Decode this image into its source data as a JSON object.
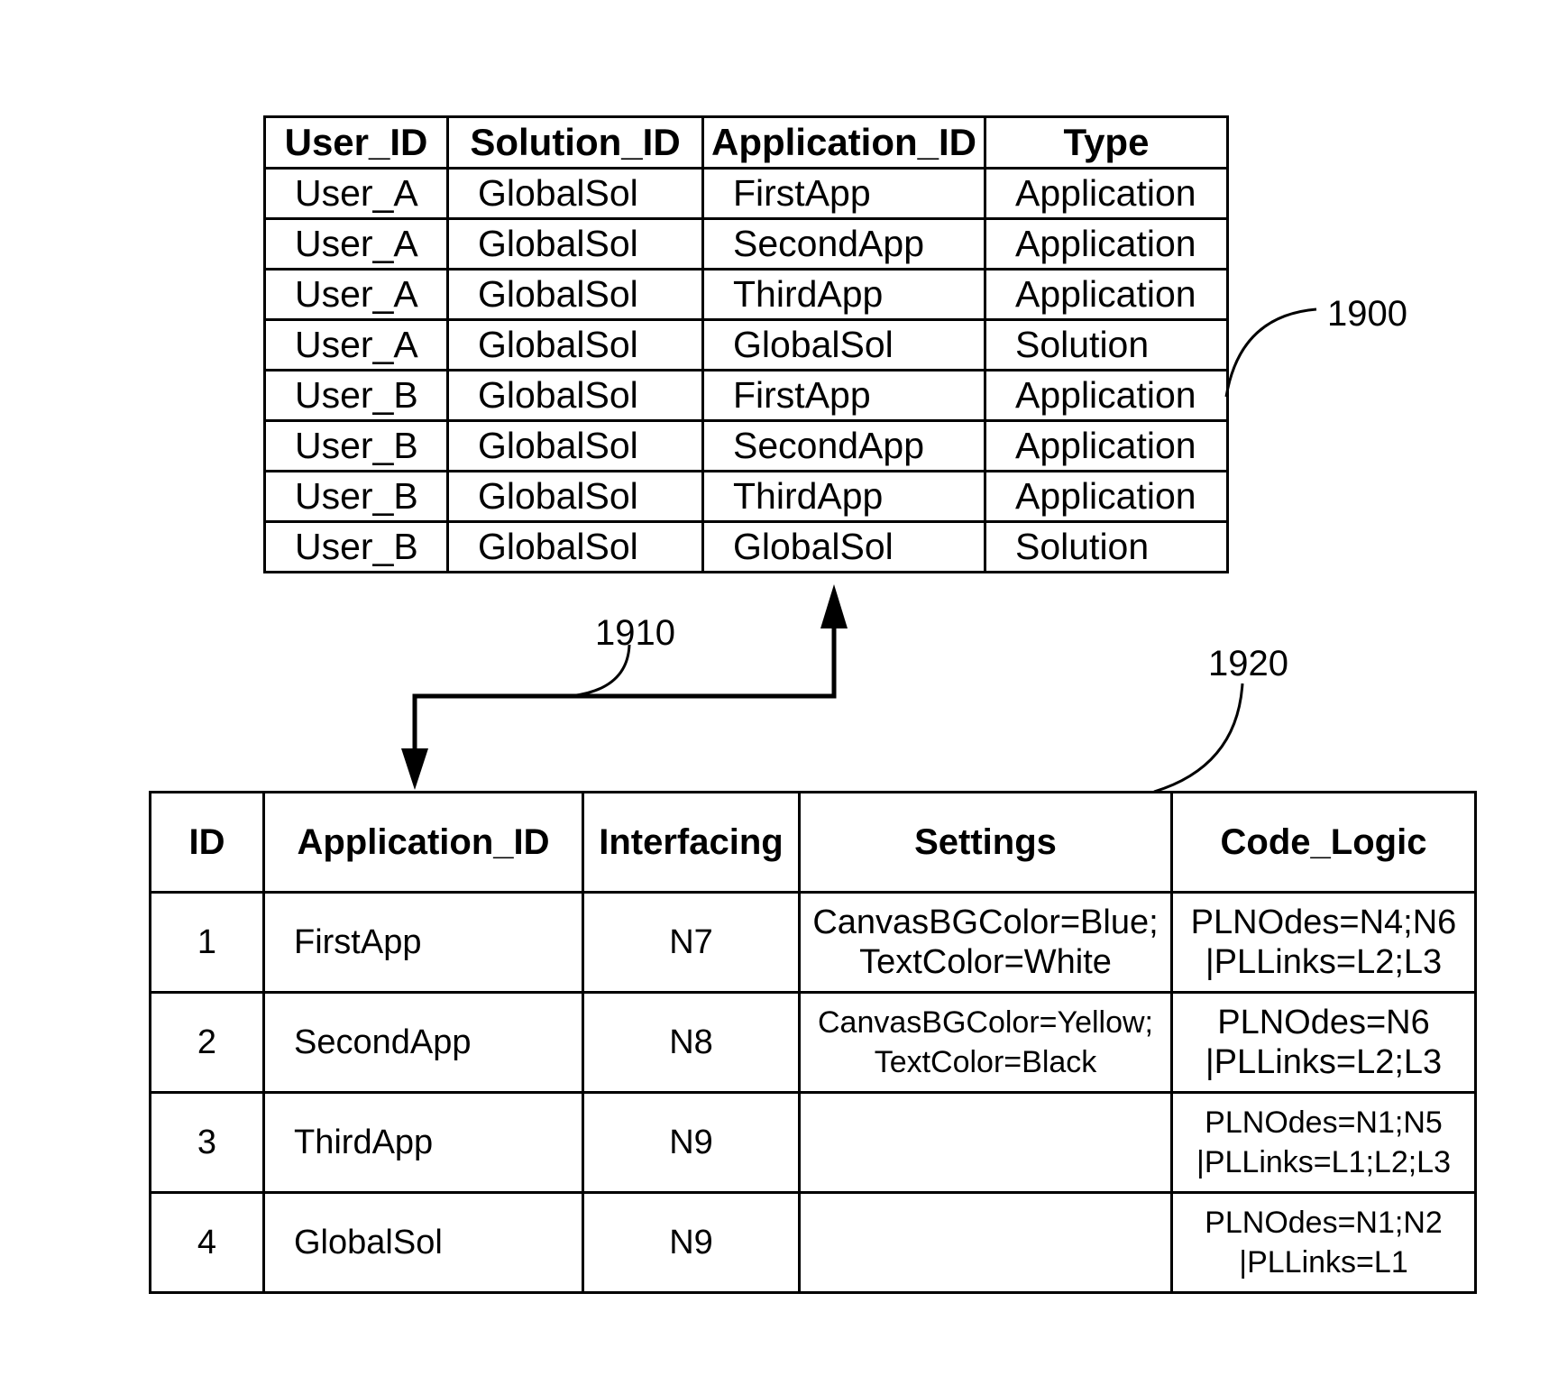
{
  "figure": {
    "labels": {
      "table_top": "1900",
      "arrow": "1910",
      "table_bottom": "1920"
    }
  },
  "user_table": {
    "headers": [
      "User_ID",
      "Solution_ID",
      "Application_ID",
      "Type"
    ],
    "rows": [
      [
        "User_A",
        "GlobalSol",
        "FirstApp",
        "Application"
      ],
      [
        "User_A",
        "GlobalSol",
        "SecondApp",
        "Application"
      ],
      [
        "User_A",
        "GlobalSol",
        "ThirdApp",
        "Application"
      ],
      [
        "User_A",
        "GlobalSol",
        "GlobalSol",
        "Solution"
      ],
      [
        "User_B",
        "GlobalSol",
        "FirstApp",
        "Application"
      ],
      [
        "User_B",
        "GlobalSol",
        "SecondApp",
        "Application"
      ],
      [
        "User_B",
        "GlobalSol",
        "ThirdApp",
        "Application"
      ],
      [
        "User_B",
        "GlobalSol",
        "GlobalSol",
        "Solution"
      ]
    ]
  },
  "app_table": {
    "headers": [
      "ID",
      "Application_ID",
      "Interfacing",
      "Settings",
      "Code_Logic"
    ],
    "rows": [
      {
        "id": "1",
        "app": "FirstApp",
        "interfacing": "N7",
        "settings": [
          "CanvasBGColor=Blue;",
          "TextColor=White"
        ],
        "code_logic": [
          "PLNOdes=N4;N6",
          "|PLLinks=L2;L3"
        ]
      },
      {
        "id": "2",
        "app": "SecondApp",
        "interfacing": "N8",
        "settings": [
          "CanvasBGColor=Yellow;",
          "TextColor=Black"
        ],
        "code_logic": [
          "PLNOdes=N6",
          "|PLLinks=L2;L3"
        ]
      },
      {
        "id": "3",
        "app": "ThirdApp",
        "interfacing": "N9",
        "settings": [
          "",
          ""
        ],
        "code_logic": [
          "PLNOdes=N1;N5",
          "|PLLinks=L1;L2;L3"
        ]
      },
      {
        "id": "4",
        "app": "GlobalSol",
        "interfacing": "N9",
        "settings": [
          "",
          ""
        ],
        "code_logic": [
          "PLNOdes=N1;N2",
          "|PLLinks=L1"
        ]
      }
    ]
  }
}
